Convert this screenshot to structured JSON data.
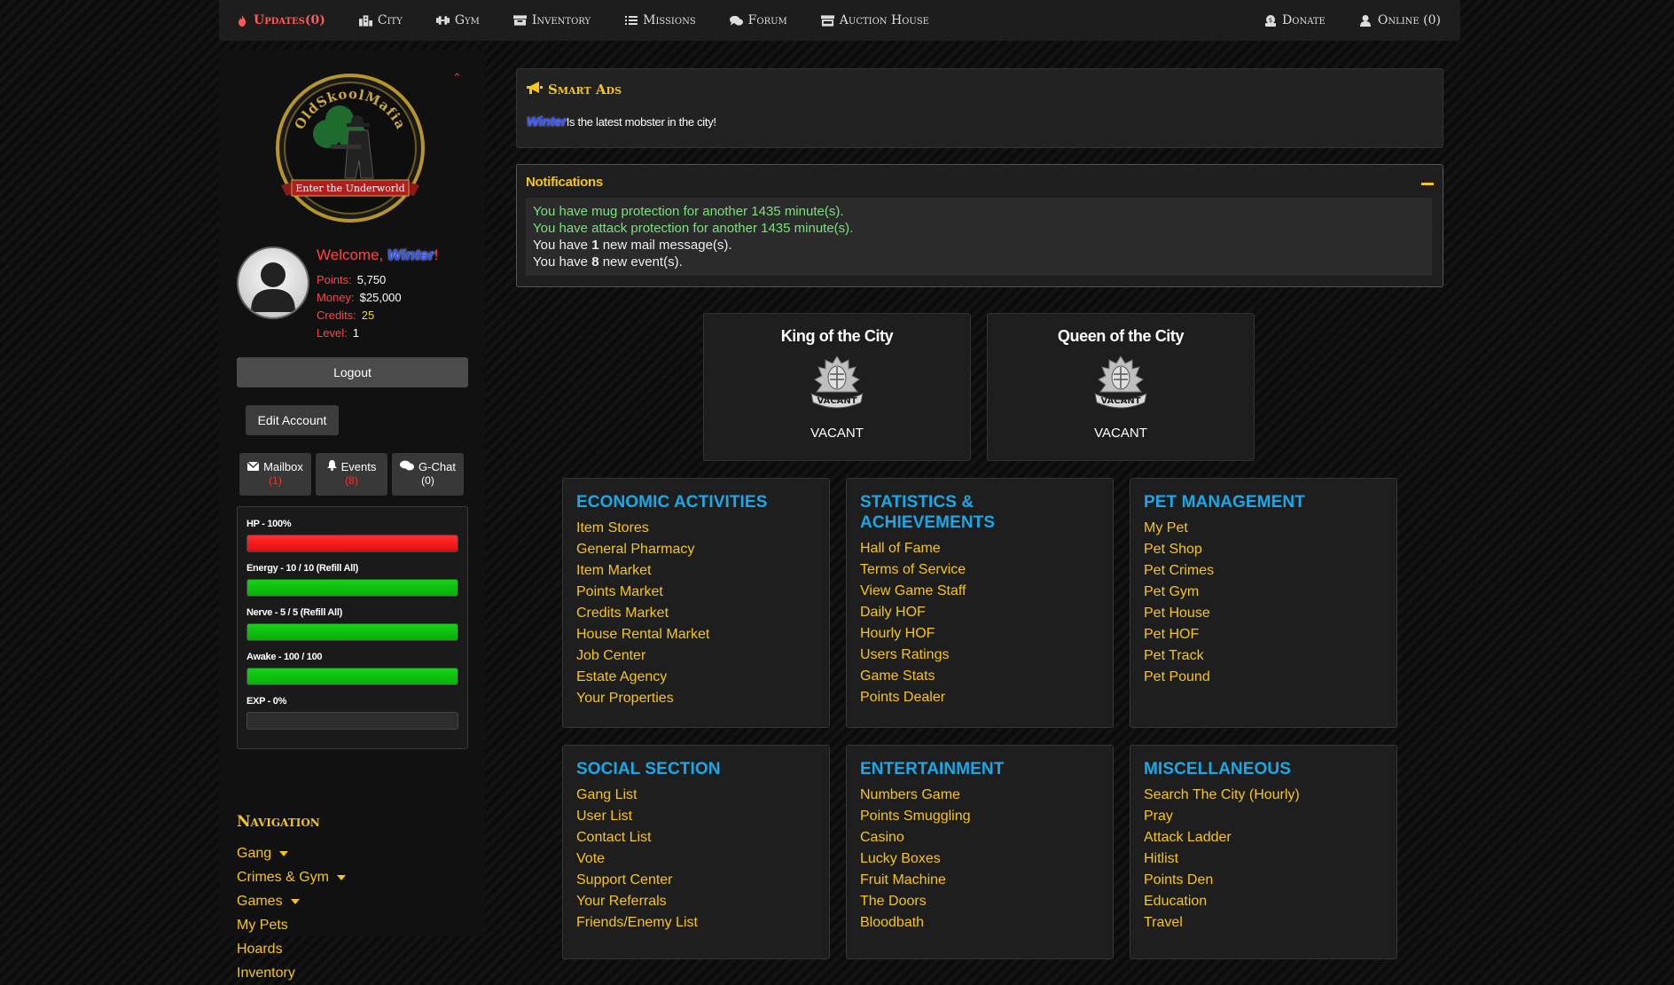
{
  "topnav": {
    "left": [
      {
        "label": "Updates(0)",
        "icon": "fire-icon"
      },
      {
        "label": "City",
        "icon": "city-icon"
      },
      {
        "label": "Gym",
        "icon": "dumbbell-icon"
      },
      {
        "label": "Inventory",
        "icon": "box-icon"
      },
      {
        "label": "Missions",
        "icon": "list-icon"
      },
      {
        "label": "Forum",
        "icon": "comments-icon"
      },
      {
        "label": "Auction House",
        "icon": "store-icon"
      }
    ],
    "right": [
      {
        "label": "Donate",
        "icon": "donate-icon"
      },
      {
        "label": "Online (0)",
        "icon": "user-icon"
      }
    ]
  },
  "sidebar": {
    "logo_text_top": "OldSkoolMafia",
    "logo_text_banner": "Enter the Underworld",
    "welcome_prefix": "Welcome, ",
    "username": "Winter",
    "welcome_suffix": "!",
    "stats": [
      {
        "label": "Points:",
        "value": "5,750"
      },
      {
        "label": "Money:",
        "value": "$25,000"
      },
      {
        "label": "Credits:",
        "value": "25"
      },
      {
        "label": "Level:",
        "value": "1"
      }
    ],
    "logout_label": "Logout",
    "edit_label": "Edit Account",
    "mini": [
      {
        "label": "Mailbox",
        "count": "(1)",
        "icon": "envelope-icon"
      },
      {
        "label": "Events",
        "count": "(8)",
        "icon": "bell-icon"
      },
      {
        "label": "G-Chat",
        "count": "(0)",
        "icon": "chat-icon"
      }
    ],
    "bars": [
      {
        "label": "HP - 100%",
        "fill": 1.0,
        "color": "red"
      },
      {
        "label": "Energy - 10 / 10 (Refill All)",
        "fill": 1.0,
        "color": "green"
      },
      {
        "label": "Nerve - 5 / 5 (Refill All)",
        "fill": 1.0,
        "color": "green"
      },
      {
        "label": "Awake - 100 / 100",
        "fill": 1.0,
        "color": "green"
      },
      {
        "label": "EXP - 0%",
        "fill": 0.0,
        "color": "green"
      }
    ],
    "nav_title": "Navigation",
    "nav": [
      {
        "label": "Gang",
        "dropdown": true
      },
      {
        "label": "Crimes & Gym",
        "dropdown": true
      },
      {
        "label": "Games",
        "dropdown": true
      },
      {
        "label": "My Pets",
        "dropdown": false
      },
      {
        "label": "Hoards",
        "dropdown": false
      },
      {
        "label": "Inventory",
        "dropdown": false
      }
    ]
  },
  "smart_ads": {
    "title": "Smart Ads",
    "username": "Winter",
    "message": "Is the latest mobster in the city!"
  },
  "notifications": {
    "title": "Notifications",
    "mug": "You have mug protection for another 1435 minute(s).",
    "attack": "You have attack protection for another 1435 minute(s).",
    "mail_pre": "You have ",
    "mail_num": "1",
    "mail_post": " new mail message(s).",
    "event_pre": "You have ",
    "event_num": "8",
    "event_post": " new event(s)."
  },
  "royalty": [
    {
      "title": "King of the City",
      "badge": "VACANT",
      "status": "VACANT"
    },
    {
      "title": "Queen of the City",
      "badge": "VACANT",
      "status": "VACANT"
    }
  ],
  "panels": [
    {
      "title": "ECONOMIC ACTIVITIES",
      "items": [
        "Item Stores",
        "General Pharmacy",
        "Item Market",
        "Points Market",
        "Credits Market",
        "House Rental Market",
        "Job Center",
        "Estate Agency",
        "Your Properties"
      ]
    },
    {
      "title": "STATISTICS & ACHIEVEMENTS",
      "items": [
        "Hall of Fame",
        "Terms of Service",
        "View Game Staff",
        "Daily HOF",
        "Hourly HOF",
        "Users Ratings",
        "Game Stats",
        "Points Dealer"
      ]
    },
    {
      "title": "PET MANAGEMENT",
      "items": [
        "My Pet",
        "Pet Shop",
        "Pet Crimes",
        "Pet Gym",
        "Pet House",
        "Pet HOF",
        "Pet Track",
        "Pet Pound"
      ]
    },
    {
      "title": "SOCIAL SECTION",
      "items": [
        "Gang List",
        "User List",
        "Contact List",
        "Vote",
        "Support Center",
        "Your Referrals",
        "Friends/Enemy List"
      ]
    },
    {
      "title": "ENTERTAINMENT",
      "items": [
        "Numbers Game",
        "Points Smuggling",
        "Casino",
        "Lucky Boxes",
        "Fruit Machine",
        "The Doors",
        "Bloodbath"
      ]
    },
    {
      "title": "MISCELLANEOUS",
      "items": [
        "Search The City (Hourly)",
        "Pray",
        "Attack Ladder",
        "Hitlist",
        "Points Den",
        "Education",
        "Travel"
      ]
    }
  ]
}
